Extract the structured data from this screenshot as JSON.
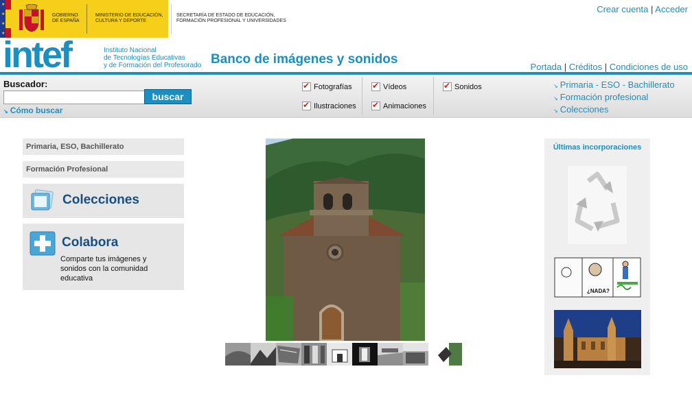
{
  "gov": {
    "gobierno": "GOBIERNO DE ESPAÑA",
    "ministerio": "MINISTERIO DE EDUCACIÓN, CULTURA Y DEPORTE",
    "secretaria": "SECRETARÍA DE ESTADO DE EDUCACIÓN, FORMACIÓN PROFESIONAL Y UNIVERSIDADES"
  },
  "brand": {
    "logo": "intef",
    "line1": "Instituto Nacional",
    "line2": "de Tecnologías Educativas",
    "line3": "y de Formación del Profesorado",
    "site_title": "Banco de imágenes y sonidos"
  },
  "top_links": {
    "crear": "Crear cuenta",
    "sep": "|",
    "acceder": "Acceder"
  },
  "foot_links": {
    "portada": "Portada",
    "creditos": "Créditos",
    "condiciones": "Condiciones de uso",
    "sep": "|"
  },
  "search": {
    "label": "Buscador:",
    "value": "",
    "button": "buscar",
    "how": "Cómo buscar"
  },
  "filters": {
    "fotografias": "Fotografías",
    "ilustraciones": "Ilustraciones",
    "videos": "Vídeos",
    "animaciones": "Animaciones",
    "sonidos": "Sonidos"
  },
  "categories": [
    "Primaria - ESO - Bachillerato",
    "Formación profesional",
    "Colecciones"
  ],
  "left": {
    "tab1": "Primaria, ESO, Bachillerato",
    "tab2": "Formación Profesional",
    "colecciones": "Colecciones",
    "colabora": "Colabora",
    "colabora_text": "Comparte tus imágenes y sonidos con la comunidad educativa"
  },
  "right": {
    "title": "Últimas incorporaciones",
    "comic_text": "¿NADA?"
  },
  "colors": {
    "brand_blue": "#1a8fc0",
    "dark_blue": "#174f82",
    "gov_yellow": "#f6cf1a"
  }
}
